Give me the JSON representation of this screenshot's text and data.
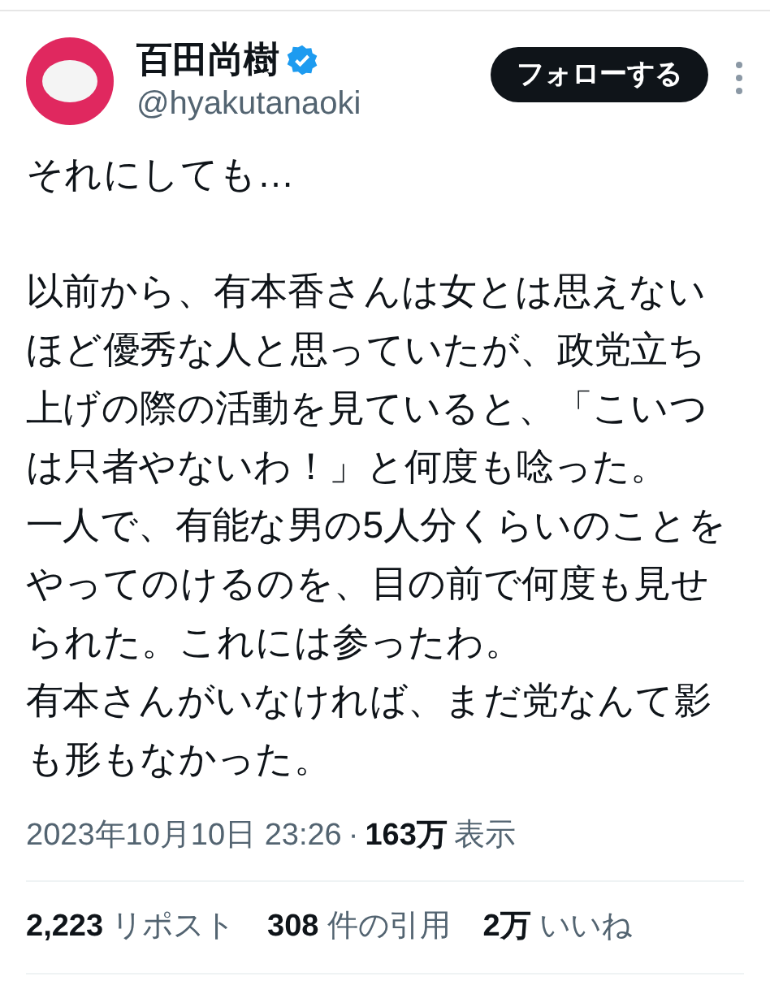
{
  "author": {
    "name": "百田尚樹",
    "verified": true,
    "handle": "@hyakutanaoki"
  },
  "follow_button": "フォローする",
  "paragraphs": [
    {
      "lines": [
        "それにしても…"
      ]
    },
    {
      "lines": [
        "以前から、有本香さんは女とは思えない",
        "ほど優秀な人と思っていたが、政党立ち",
        "上げの際の活動を見ていると、「こいつ",
        "は只者やないわ！」と何度も唸った。",
        "一人で、有能な男の5人分くらいのことを",
        "やってのけるのを、目の前で何度も見せ",
        "られた。これには参ったわ。",
        "有本さんがいなければ、まだ党なんて影",
        "も形もなかった。"
      ]
    }
  ],
  "timestamp": "2023年10月10日 23:26",
  "separator": "·",
  "views": {
    "count": "163万",
    "label": "表示"
  },
  "stats": [
    {
      "count": "2,223",
      "label": "リポスト"
    },
    {
      "count": "308",
      "label": "件の引用"
    },
    {
      "count": "2万",
      "label": "いいね"
    }
  ]
}
